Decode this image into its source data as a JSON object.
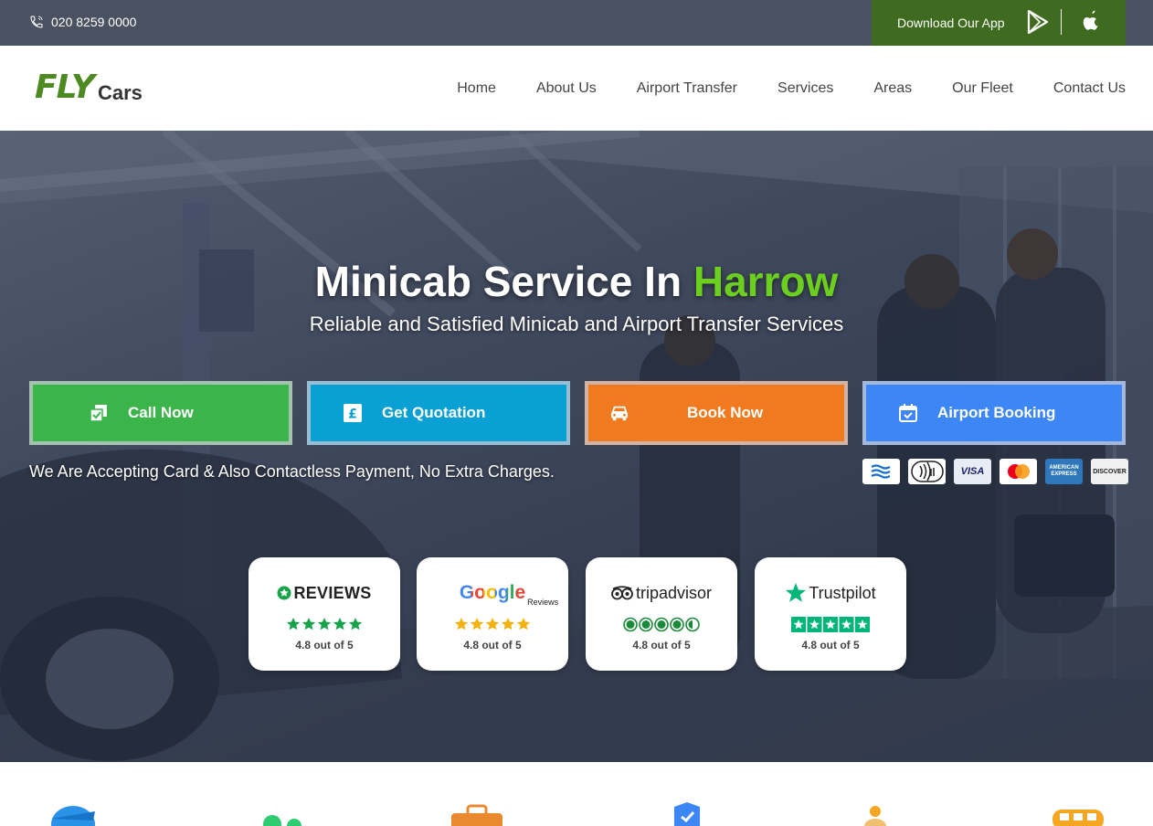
{
  "topbar": {
    "phone": "020 8259 0000",
    "app_label": "Download Our App"
  },
  "header": {
    "logo_fly": "FLY",
    "logo_cars": "Cars",
    "nav": [
      "Home",
      "About Us",
      "Airport Transfer",
      "Services",
      "Areas",
      "Our Fleet",
      "Contact Us"
    ]
  },
  "hero": {
    "title_prefix": "Minicab Service In ",
    "title_highlight": "Harrow",
    "subtitle": "Reliable and Satisfied Minicab and Airport Transfer Services",
    "buttons": {
      "call": "Call Now",
      "quote": "Get Quotation",
      "book": "Book Now",
      "airport": "Airport Booking"
    },
    "accept_text": "We Are Accepting Card & Also Contactless Payment, No Extra Charges.",
    "payment_cards": [
      "VISA",
      "AMERICAN EXPRESS",
      "DISCOVER"
    ],
    "reviews": [
      {
        "brand": "REVIEWS",
        "score": "4.8 out of 5"
      },
      {
        "brand": "Google",
        "sub": "Reviews",
        "score": "4.8 out of 5"
      },
      {
        "brand": "tripadvisor",
        "score": "4.8 out of 5"
      },
      {
        "brand": "Trustpilot",
        "score": "4.8 out of 5"
      }
    ]
  },
  "colors": {
    "topbar": "#4a5160",
    "app_box": "#3e6b1f",
    "brand_green": "#4d8a22",
    "highlight": "#6ccf1f",
    "call": "#3bb54a",
    "quote": "#0ba0d4",
    "book": "#f07a1f",
    "airport": "#3d86f5"
  }
}
